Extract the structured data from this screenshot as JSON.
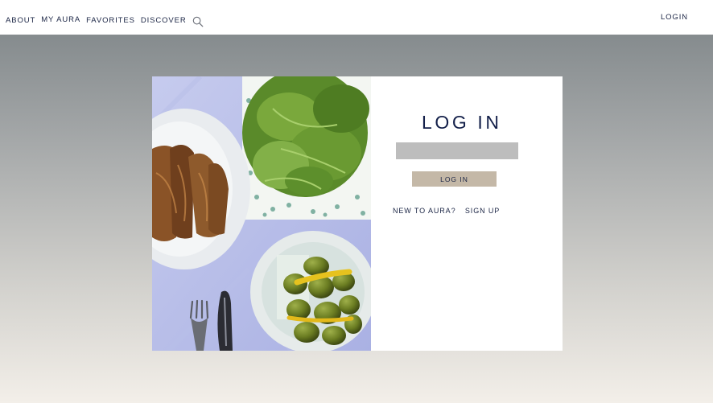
{
  "nav": {
    "items": [
      {
        "label": "ABOUT"
      },
      {
        "label": "MY AURA"
      },
      {
        "label": "FAVORITES"
      },
      {
        "label": "DISCOVER"
      }
    ],
    "search_icon": "search-icon",
    "login_label": "LOGIN"
  },
  "login": {
    "title": "LOG IN",
    "input_value": "",
    "button_label": "LOG IN",
    "new_prompt": "NEW TO AURA?",
    "signup_label": "SIGN UP"
  },
  "colors": {
    "nav_text": "#1a2444",
    "title_text": "#14204a",
    "input_bg": "#bdbdbd",
    "button_bg": "#c4b8a7",
    "modal_bg": "#ffffff"
  }
}
